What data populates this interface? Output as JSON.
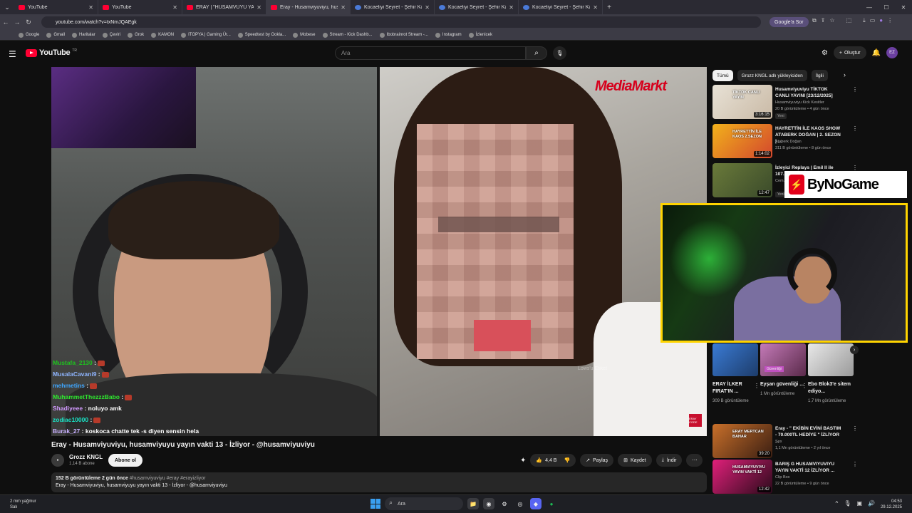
{
  "browser": {
    "tabs": [
      {
        "title": "YouTube",
        "icon": "youtube-icon"
      },
      {
        "title": "YouTube",
        "icon": "youtube-icon"
      },
      {
        "title": "ERAY | \"HUSAMVUYU YAYIN V...",
        "icon": "youtube-icon"
      },
      {
        "title": "Eray - Husamviyuviyu, husa",
        "icon": "youtube-icon"
      },
      {
        "title": "Kocaeliyi Seyret - Şehir Kamera",
        "icon": "globe-icon"
      },
      {
        "title": "Kocaeliyi Seyret - Şehir Kamera",
        "icon": "globe-icon"
      },
      {
        "title": "Kocaeliyi Seyret - Şehir Kamera",
        "icon": "globe-icon"
      }
    ],
    "active_tab": 3,
    "url": "youtube.com/watch?v=txNmJQAEgk",
    "google_sor": "Google'a Sor",
    "bookmarks": [
      "Google",
      "Gmail",
      "Haritalar",
      "Çeviri",
      "Grok",
      "KAMON",
      "ITOPYA | Gaming Ür...",
      "Speedtest by Ookla...",
      "Mobese",
      "Stream - Kick Dashb...",
      "Ibobrainrot Stream -...",
      "Instagram",
      "İzlenicek"
    ]
  },
  "youtube": {
    "logo": "YouTube",
    "logo_region": "TR",
    "search_placeholder": "Ara",
    "create_label": "Oluştur",
    "avatar_initials": "EZ"
  },
  "video": {
    "overlay_brand": "MediaMarkt",
    "watermark": "Lows'u Etiket",
    "chat": [
      {
        "user": "Mustafa_2130",
        "msg": ":",
        "color": "#1ec21e"
      },
      {
        "user": "MusalaCavani9",
        "msg": ":",
        "color": "#8fb5ff"
      },
      {
        "user": "mehmetins",
        "msg": ":",
        "color": "#3ea6ff"
      },
      {
        "user": "MuhammetThezzzBabo",
        "msg": ":",
        "color": "#2ee62e"
      },
      {
        "user": "Shadiyeee",
        "msg": ": noluyo amk",
        "color": "#d29bff"
      },
      {
        "user": "zodiac10000",
        "msg": ":",
        "color": "#19e6c8"
      },
      {
        "user": "Burak_27",
        "msg": ": koskoca chatte tek -s diyen sensin hela",
        "color": "#c8b0ff"
      }
    ],
    "corner_logo": "ERAY CODE",
    "title": "Eray - Husamviyuviyu, husamviyuyu yayın vakti 13 - İzliyor - @husamviyuviyu",
    "channel": "Grozz KNGL",
    "subs": "1,14 B abone",
    "subscribe": "Abone ol",
    "likes": "4,4 B",
    "share": "Paylaş",
    "save": "Kaydet",
    "download": "İndir",
    "desc_stats": "152 B görüntüleme  2 gün önce",
    "desc_tags": "#husamviyuviyu #eray #erayizliyor",
    "desc_text": "Eray - Husamviyuviyu, husamviyuyu yayın vakti 13 - İzliyor - @husamviyuviyu"
  },
  "sidebar": {
    "chips": [
      "Tümü",
      "Grozz KNGL adlı yükleyiciden",
      "İlgili"
    ],
    "recs": [
      {
        "title": "Husamviyuviyu TİKTOK CANLI YAYINI [23/12/2025]",
        "channel": "Husamviyuviyu Kick Kesitler",
        "meta": "20 B görüntüleme • 4 gün önce",
        "dur": "3:16:15",
        "badge": "Yeni",
        "thumb_text": "TİKTOK CANLI YAYIN"
      },
      {
        "title": "HAYRETTİN İLE KAOS SHOW ATABERK DOĞAN | 2. SEZON | ...",
        "channel": "Ataberk Doğan",
        "meta": "311 B görüntüleme • 8 gün önce",
        "dur": "1:14:02",
        "badge": "",
        "thumb_text": "HAYRETTİN İLE KAOS 2.SEZON"
      },
      {
        "title": "İzleyici Replays | Emil II ile 107...",
        "channel": "Cem...",
        "meta": "",
        "dur": "12:47",
        "badge": "Yeni",
        "thumb_text": ""
      }
    ],
    "bynogame": "ByNoGame",
    "shorts": [
      {
        "title": "ERAY İLKER FIRAT'IN ...",
        "meta": "309 B görüntüleme",
        "thumb_text": ""
      },
      {
        "title": "Eyşan güvenliği ...",
        "meta": "1 Mn görüntüleme",
        "thumb_text": "Güvenliği"
      },
      {
        "title": "Ebo Blok3'e sitem ediyo...",
        "meta": "1,7 Mn görüntüleme",
        "thumb_text": ""
      }
    ],
    "recs2": [
      {
        "title": "Eray - \" EKİBİN EVİNİ BASTIM - 70.000TL HEDİYE \" İZLİYOR ...",
        "channel": "Sox",
        "meta": "1,1 Mn görüntüleme • 2 yıl önce",
        "dur": "39:20",
        "thumb_text": "ERAY MERTCAN BAHAR"
      },
      {
        "title": "BARIŞ G HUSAMVIYUVIYU YAYIN VAKTİ 12 İZLİYOR ...",
        "channel": "Clip Box",
        "meta": "22 B görüntüleme • 9 gün önce",
        "dur": "12:42",
        "thumb_text": "HUSAMVIYUVIYU YAYIN VAKTİ 12"
      }
    ]
  },
  "taskbar": {
    "weather_line1": "2 mm yağmur",
    "weather_line2": "Salı",
    "search": "Ara",
    "time": "04:53",
    "date": "29.12.2025"
  }
}
